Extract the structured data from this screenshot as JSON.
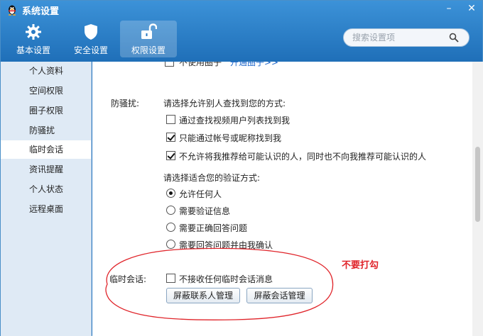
{
  "window": {
    "title": "系统设置",
    "minimize_symbol": "–",
    "close_symbol": "✕"
  },
  "toolbar": {
    "buttons": [
      {
        "label": "基本设置",
        "icon": "gear-icon"
      },
      {
        "label": "安全设置",
        "icon": "shield-icon"
      },
      {
        "label": "权限设置",
        "icon": "lock-icon",
        "active": true
      }
    ]
  },
  "search": {
    "placeholder": "搜索设置项"
  },
  "sidebar": {
    "items": [
      {
        "label": "个人资料"
      },
      {
        "label": "空间权限"
      },
      {
        "label": "圈子权限"
      },
      {
        "label": "防骚扰"
      },
      {
        "label": "临时会话",
        "active": true
      },
      {
        "label": "资讯提醒"
      },
      {
        "label": "个人状态"
      },
      {
        "label": "远程桌面"
      }
    ]
  },
  "content": {
    "top_partial": {
      "checkbox_label": "不使用圈子",
      "link": "开通圈子>>"
    },
    "anti_harass": {
      "section_label": "防骚扰:",
      "find_prompt": "请选择允许别人查找到您的方式:",
      "find_options": [
        {
          "label": "通过查找视频用户列表找到我",
          "checked": false
        },
        {
          "label": "只能通过帐号或昵称找到我",
          "checked": true
        },
        {
          "label": "不允许将我推荐给可能认识的人，同时也不向我推荐可能认识的人",
          "checked": true
        }
      ],
      "verify_prompt": "请选择适合您的验证方式:",
      "verify_options": [
        {
          "label": "允许任何人",
          "selected": true
        },
        {
          "label": "需要验证信息",
          "selected": false
        },
        {
          "label": "需要正确回答问题",
          "selected": false
        },
        {
          "label": "需要回答问题并由我确认",
          "selected": false
        }
      ]
    },
    "temp_session": {
      "section_label": "临时会话:",
      "checkbox_label": "不接收任何临时会话消息",
      "checked": false,
      "buttons": [
        "屏蔽联系人管理",
        "屏蔽会话管理"
      ]
    },
    "annotation": "不要打勾"
  },
  "colors": {
    "titlebar": "#2a7ac4",
    "sidebar_bg": "#dfeaf5",
    "annotation_red": "#e0242a",
    "link_blue": "#1a64c9"
  }
}
